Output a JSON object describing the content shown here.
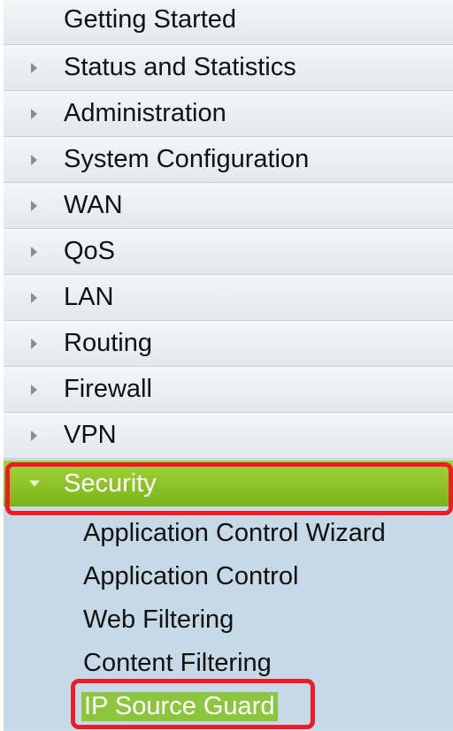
{
  "nav": {
    "items": [
      {
        "label": "Getting Started",
        "has_arrow": false
      },
      {
        "label": "Status and Statistics",
        "has_arrow": true
      },
      {
        "label": "Administration",
        "has_arrow": true
      },
      {
        "label": "System Configuration",
        "has_arrow": true
      },
      {
        "label": "WAN",
        "has_arrow": true
      },
      {
        "label": "QoS",
        "has_arrow": true
      },
      {
        "label": "LAN",
        "has_arrow": true
      },
      {
        "label": "Routing",
        "has_arrow": true
      },
      {
        "label": "Firewall",
        "has_arrow": true
      },
      {
        "label": "VPN",
        "has_arrow": true
      }
    ],
    "active": {
      "label": "Security",
      "expanded": true
    },
    "submenu": [
      {
        "label": "Application Control Wizard"
      },
      {
        "label": "Application Control"
      },
      {
        "label": "Web Filtering"
      },
      {
        "label": "Content Filtering"
      },
      {
        "label": "IP Source Guard",
        "selected": true
      }
    ]
  },
  "colors": {
    "active_green": "#8cc63f",
    "highlight_red": "#ee1c24",
    "submenu_bg": "#c6d9e7"
  },
  "icons": {
    "collapsed": "triangle-right-icon",
    "expanded": "triangle-down-icon"
  }
}
